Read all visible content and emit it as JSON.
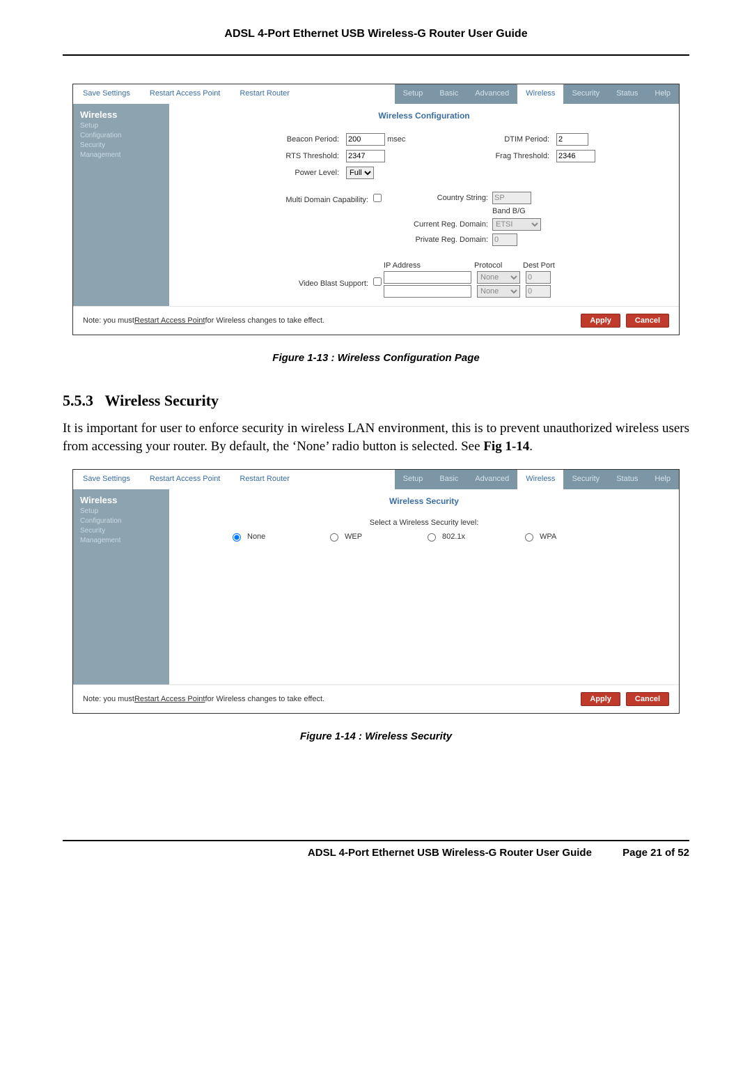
{
  "doc": {
    "header": "ADSL 4-Port Ethernet USB Wireless-G Router User Guide",
    "footer_title": "ADSL 4-Port Ethernet USB Wireless-G Router User Guide",
    "footer_page": "Page 21 of 52"
  },
  "fig13_caption": "Figure 1-13 : Wireless Configuration Page",
  "fig14_caption": "Figure 1-14 : Wireless Security",
  "section": {
    "num": "5.5.3",
    "title": "Wireless Security",
    "para": "It is important for user to enforce security in wireless LAN environment, this is to prevent unauthorized wireless users from accessing your router. By default, the ‘None’ radio button is selected. See Fig 1-14."
  },
  "topbar": {
    "save": "Save Settings",
    "restart_ap": "Restart Access Point",
    "restart_router": "Restart Router",
    "tabs": [
      "Setup",
      "Basic",
      "Advanced",
      "Wireless",
      "Security",
      "Status",
      "Help"
    ],
    "active_tab": "Wireless"
  },
  "sidebar": {
    "head": "Wireless",
    "items": [
      "Setup",
      "Configuration",
      "Security",
      "Management"
    ]
  },
  "cfg_panel": {
    "title": "Wireless Configuration",
    "beacon_label": "Beacon Period:",
    "beacon_value": "200",
    "beacon_unit": "msec",
    "dtim_label": "DTIM Period:",
    "dtim_value": "2",
    "rts_label": "RTS Threshold:",
    "rts_value": "2347",
    "frag_label": "Frag Threshold:",
    "frag_value": "2346",
    "power_label": "Power Level:",
    "power_value": "Full",
    "mdc_label": "Multi Domain Capability:",
    "country_label": "Country String:",
    "country_value": "SP",
    "band_label": "Band B/G",
    "crd_label": "Current Reg. Domain:",
    "crd_value": "ETSI",
    "prd_label": "Private Reg. Domain:",
    "prd_value": "0",
    "vbs_label": "Video Blast Support:",
    "ip_head": "IP Address",
    "proto_head": "Protocol",
    "port_head": "Dest Port",
    "proto_value": "None",
    "port_value": "0",
    "note_pre": "Note: you must ",
    "note_link": "Restart Access Point",
    "note_post": " for Wireless changes to take effect.",
    "apply": "Apply",
    "cancel": "Cancel"
  },
  "sec_panel": {
    "title": "Wireless Security",
    "select_label": "Select a Wireless Security level:",
    "options": [
      "None",
      "WEP",
      "802.1x",
      "WPA"
    ],
    "selected": "None",
    "note_pre": "Note: you must ",
    "note_link": "Restart Access Point",
    "note_post": " for Wireless changes to take effect.",
    "apply": "Apply",
    "cancel": "Cancel"
  }
}
